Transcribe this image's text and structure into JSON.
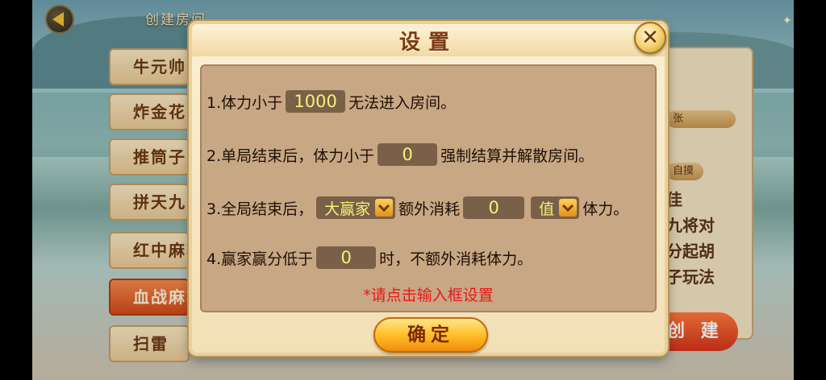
{
  "header": {
    "title": "创建房间"
  },
  "sidebar": {
    "tabs": [
      {
        "label": "牛元帅"
      },
      {
        "label": "炸金花"
      },
      {
        "label": "推筒子"
      },
      {
        "label": "拼天九"
      },
      {
        "label": "红中麻将"
      },
      {
        "label": "血战麻将",
        "active": true
      },
      {
        "label": "扫雷"
      }
    ]
  },
  "background_panel": {
    "pill_1": "张",
    "pill_2": "自摸",
    "lines": [
      "佳",
      "九将对",
      "分起胡",
      "子玩法"
    ],
    "create_label": "创 建"
  },
  "dialog": {
    "title": "设置",
    "row1": {
      "prefix": "1.体力小于",
      "value": "1000",
      "suffix": "无法进入房间。"
    },
    "row2": {
      "prefix": "2.单局结束后，体力小于",
      "value": "0",
      "suffix": "强制结算并解散房间。"
    },
    "row3": {
      "prefix": "3.全局结束后，",
      "winner_select": "大赢家",
      "middle": "额外消耗",
      "value": "0",
      "unit_select": "值",
      "suffix": "体力。"
    },
    "row4": {
      "prefix": "4.赢家赢分低于",
      "value": "0",
      "suffix": "时，不额外消耗体力。"
    },
    "hint": "*请点击输入框设置",
    "confirm_label": "确定"
  },
  "colors": {
    "field_text": "#f6f07a",
    "hint": "#e8181a",
    "title": "#7a3a12"
  },
  "icons": [
    "back-arrow-icon",
    "close-icon",
    "chevron-down-icon",
    "sparkle-icon"
  ]
}
